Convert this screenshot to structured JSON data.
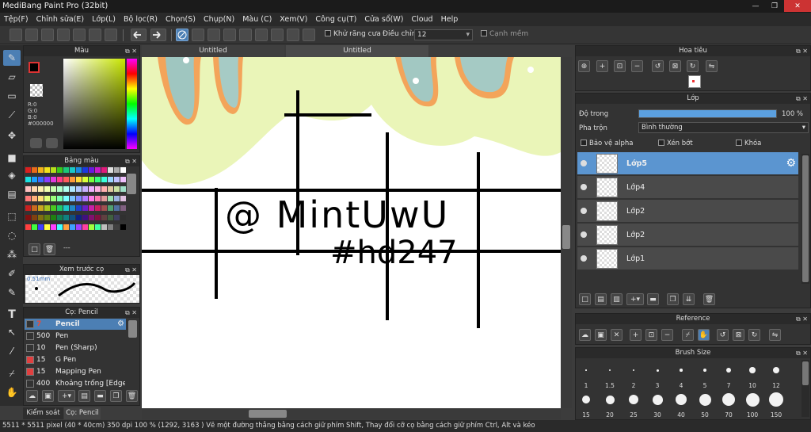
{
  "window": {
    "title": "MediBang Paint Pro (32bit)",
    "min": "—",
    "max": "❐",
    "close": "✕"
  },
  "menu": [
    "Tệp(F)",
    "Chỉnh sửa(E)",
    "Lớp(L)",
    "Bộ lọc(R)",
    "Chọn(S)",
    "Chụp(N)",
    "Màu (C)",
    "Xem(V)",
    "Công cụ(T)",
    "Cửa sổ(W)",
    "Cloud",
    "Help"
  ],
  "toolbar": {
    "antialias_label": "Khử răng cưa",
    "adjust_label": "Điều chỉnh",
    "adjust_value": "12",
    "edge_label": "Cạnh mềm"
  },
  "tabs": [
    "Untitled",
    "Untitled"
  ],
  "color_panel": {
    "title": "Màu",
    "r": "R:0",
    "g": "G:0",
    "b": "B:0",
    "hex": "#000000"
  },
  "palette_panel": {
    "title": "Bảng màu",
    "more": "---"
  },
  "brush_preview": {
    "title": "Xem trước cọ",
    "size": "0.51mm"
  },
  "brush_panel": {
    "title": "Cọ: Pencil",
    "brushes": [
      {
        "size": "7",
        "name": "Pencil",
        "color": "#c0392b"
      },
      {
        "size": "500",
        "name": "Pen",
        "color": "#333333"
      },
      {
        "size": "10",
        "name": "Pen (Sharp)",
        "color": "#333333"
      },
      {
        "size": "15",
        "name": "G Pen",
        "color": "#e04040"
      },
      {
        "size": "15",
        "name": "Mapping Pen",
        "color": "#e04040"
      },
      {
        "size": "400",
        "name": "Khoảng trống [Edge M",
        "color": "#333333"
      }
    ],
    "bottom_tabs": [
      "Kiểm soát cọ",
      "Cọ: Pencil"
    ]
  },
  "navigator": {
    "title": "Hoa tiêu"
  },
  "layer_panel": {
    "title": "Lớp",
    "opacity_label": "Độ trong",
    "opacity_value": "100 %",
    "opacity": 1.0,
    "blend_label": "Pha trộn",
    "blend_value": "Bình thường",
    "protect_alpha": "Bảo vệ alpha",
    "clipping": "Xén bớt",
    "lock": "Khóa",
    "layers": [
      "Lớp5",
      "Lớp4",
      "Lớp2",
      "Lớp2",
      "Lớp1"
    ]
  },
  "reference": {
    "title": "Reference"
  },
  "brush_size": {
    "title": "Brush Size",
    "row1": [
      "1",
      "1.5",
      "2",
      "3",
      "4",
      "5",
      "7",
      "10",
      "12"
    ],
    "row2": [
      "15",
      "20",
      "25",
      "30",
      "40",
      "50",
      "70",
      "100",
      "150"
    ]
  },
  "canvas": {
    "text1": "@ MintUwU",
    "text2": "#hd247"
  },
  "status": "5511 * 5511 pixel  (40 * 40cm)  350 dpi  100 %  (1292, 3163 )  Vẽ một đường thẳng bằng cách giữ phím Shift, Thay đổi cỡ cọ bằng cách giữ phím Ctrl, Alt và kéo",
  "colors": {
    "accent": "#4c7fb4",
    "layer_sel": "#5b95d0",
    "bg": "#3c3c3c"
  }
}
